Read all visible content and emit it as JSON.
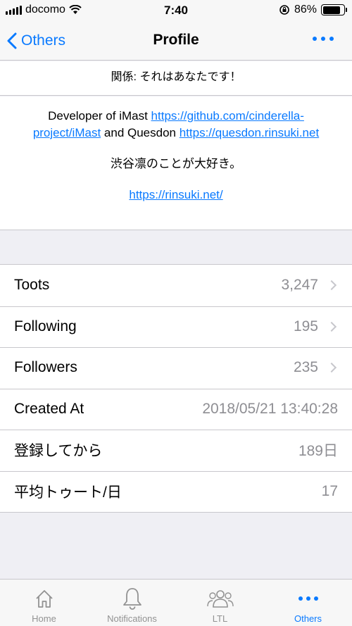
{
  "status": {
    "carrier": "docomo",
    "time": "7:40",
    "battery": "86%",
    "battery_level": 0.86
  },
  "nav": {
    "back_label": "Others",
    "title": "Profile"
  },
  "relation": "関係: それはあなたです！",
  "bio": {
    "line1_text1": "Developer of iMast ",
    "line1_link1": "https://github.com/cinderella-project/iMast",
    "line1_text2": " and Quesdon ",
    "line1_link2": "https://quesdon.rinsuki.net",
    "line2": "渋谷凛のことが大好き。",
    "line3_link": "https://rinsuki.net/"
  },
  "stats": [
    {
      "label": "Toots",
      "value": "3,247"
    },
    {
      "label": "Following",
      "value": "195"
    },
    {
      "label": "Followers",
      "value": "235"
    },
    {
      "label": "Created At",
      "value": "2018/05/21 13:40:28"
    },
    {
      "label": "登録してから",
      "value": "189日"
    },
    {
      "label": "平均トゥート/日",
      "value": "17"
    }
  ],
  "tabs": [
    {
      "label": "Home",
      "icon": "home-icon"
    },
    {
      "label": "Notifications",
      "icon": "bell-icon"
    },
    {
      "label": "LTL",
      "icon": "people-icon"
    },
    {
      "label": "Others",
      "icon": "more-icon"
    }
  ],
  "colors": {
    "accent": "#0a7aff",
    "background": "#efeff4"
  }
}
